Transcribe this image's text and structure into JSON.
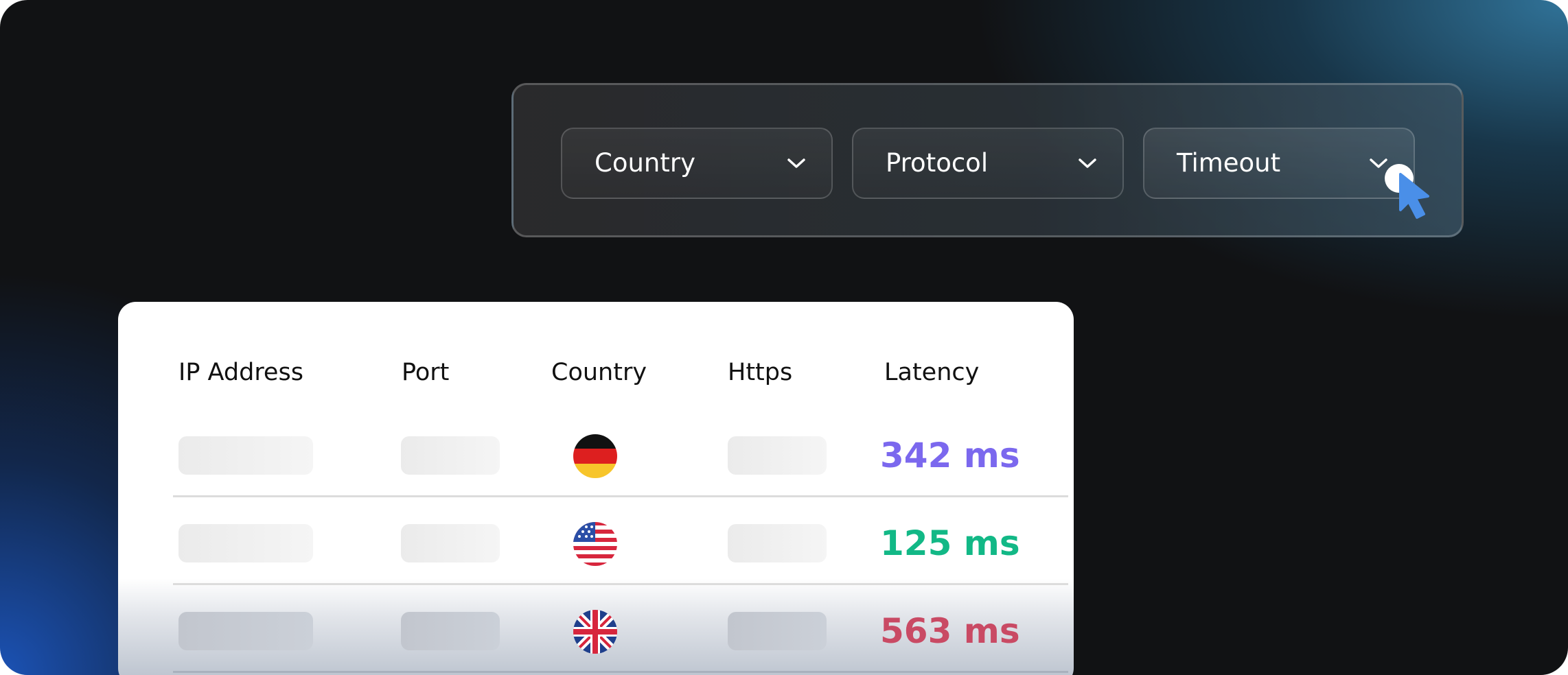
{
  "filters": [
    {
      "label": "Country"
    },
    {
      "label": "Protocol"
    },
    {
      "label": "Timeout"
    }
  ],
  "table": {
    "headers": {
      "ip": "IP Address",
      "port": "Port",
      "country": "Country",
      "https": "Https",
      "latency": "Latency"
    },
    "rows": [
      {
        "flag": "germany-flag-icon",
        "latency": "342 ms",
        "latency_color": "#7B68EE"
      },
      {
        "flag": "usa-flag-icon",
        "latency": "125 ms",
        "latency_color": "#12B886"
      },
      {
        "flag": "uk-flag-icon",
        "latency": "563 ms",
        "latency_color": "#C94A64"
      }
    ]
  },
  "colors": {
    "background": "#111214",
    "accent_blue": "#1E5AB4",
    "cursor": "#4A8FE8"
  }
}
